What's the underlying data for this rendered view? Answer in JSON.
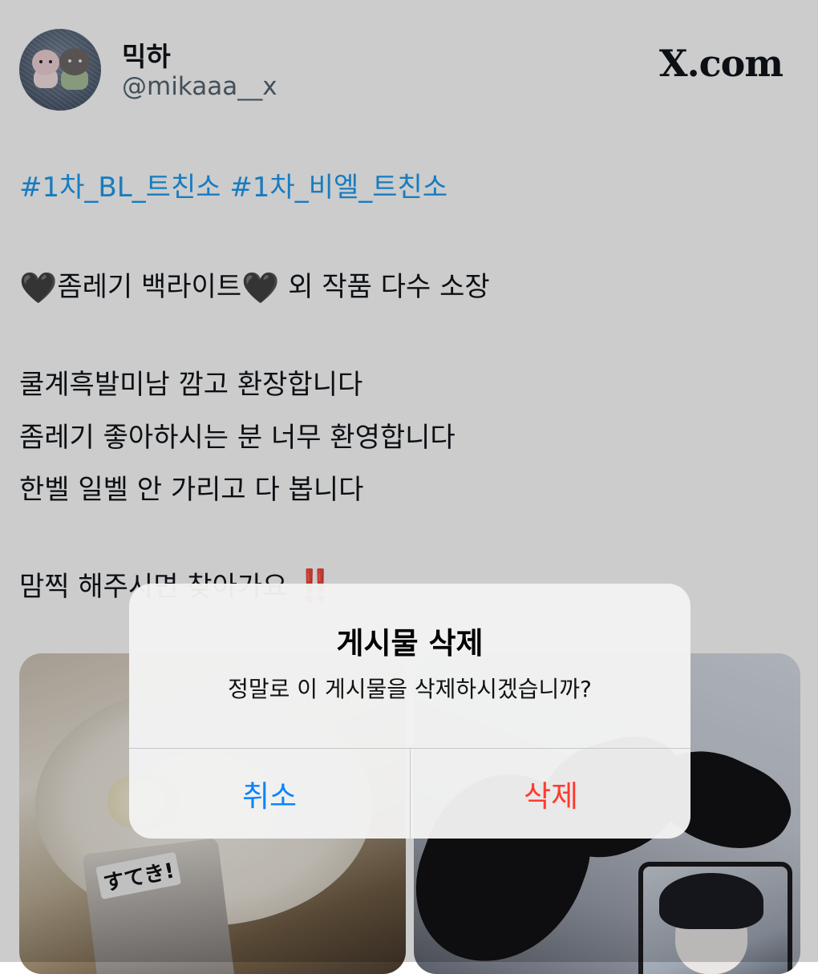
{
  "profile": {
    "display_name": "믹하",
    "handle": "@mikaaa__x",
    "brand": "X.com"
  },
  "tweet": {
    "hashtags": "#1차_BL_트친소 #1차_비엘_트친소",
    "line1_before": "좀레기 백라이트",
    "line1_after": " 외 작품 다수 소장",
    "line2": "쿨계흑발미남 깜고 환장합니다",
    "line3": "좀레기 좋아하시는 분 너무 환영합니다",
    "line4": "한벨 일벨 안 가리고 다 봅니다",
    "line5": "맘찍 해주시면 찾아가요",
    "heart_emoji": "🖤",
    "bang_emoji": "‼️"
  },
  "photos": {
    "left_card_title": "すてき!"
  },
  "alert": {
    "title": "게시물 삭제",
    "message": "정말로 이 게시물을 삭제하시겠습니까?",
    "cancel_label": "취소",
    "delete_label": "삭제"
  },
  "colors": {
    "link": "#1d9bf0",
    "cancel": "#0a84ff",
    "destructive": "#ff3b30",
    "alert_bg": "#f2f2f2"
  }
}
